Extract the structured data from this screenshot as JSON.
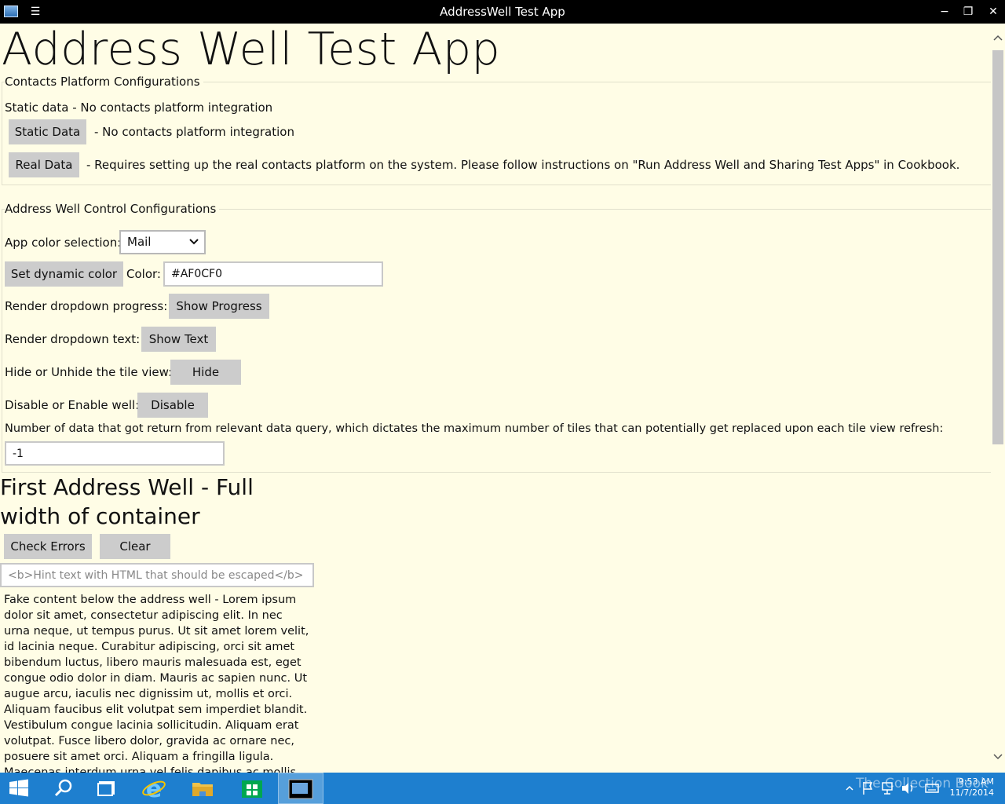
{
  "window": {
    "title": "AddressWell Test App",
    "controls": {
      "minimize": "−",
      "maximize": "❐",
      "close": "✕"
    }
  },
  "page": {
    "heading": "Address Well Test App"
  },
  "platform_section": {
    "legend": "Contacts Platform Configurations",
    "static_label": "Static data - No contacts platform integration",
    "static_button": "Static Data",
    "static_desc": "- No contacts platform integration",
    "real_button": "Real Data",
    "real_desc": "- Requires setting up the real contacts platform on the system. Please follow instructions on \"Run Address Well and Sharing Test Apps\" in Cookbook."
  },
  "control_section": {
    "legend": "Address Well Control Configurations",
    "color_selection_label": "App color selection:",
    "color_selection_value": "Mail",
    "set_dynamic_button": "Set dynamic color",
    "color_label": "Color:",
    "color_value": "#AF0CF0",
    "progress_label": "Render dropdown progress:",
    "progress_button": "Show Progress",
    "text_label": "Render dropdown text:",
    "text_button": "Show Text",
    "tile_label": "Hide or Unhide the tile view:",
    "tile_button": "Hide",
    "disable_label": "Disable or Enable well:",
    "disable_button": "Disable",
    "query_label": "Number of data that got return from relevant data query, which dictates the maximum number of tiles that can potentially get replaced upon each tile view refresh:",
    "query_value": "-1"
  },
  "first_well": {
    "heading": "First Address Well - Full width of container",
    "check_errors_button": "Check Errors",
    "clear_button": "Clear",
    "hint_placeholder": "<b>Hint text with HTML that should be escaped</b>",
    "content_text": "Fake content below the address well - Lorem ipsum dolor sit amet, consectetur adipiscing elit. In nec urna neque, ut tempus purus. Ut sit amet lorem velit, id lacinia neque. Curabitur adipiscing, orci sit amet bibendum luctus, libero mauris malesuada est, eget congue odio dolor in diam. Mauris ac sapien nunc. Ut augue arcu, iaculis nec dignissim ut, mollis et orci. Aliquam faucibus elit volutpat sem imperdiet blandit. Vestibulum congue lacinia sollicitudin. Aliquam erat volutpat. Fusce libero dolor, gravida ac ornare nec, posuere sit amet orci. Aliquam a fringilla ligula. Maecenas interdum urna vel felis dapibus ac mollis"
  },
  "taskbar": {
    "items": [
      "start-icon",
      "search-icon",
      "task-view-icon",
      "internet-explorer-icon",
      "file-explorer-icon",
      "store-icon",
      "addresswell-app-icon"
    ],
    "watermark": "The Collection Book",
    "time": "9:53 AM",
    "date": "11/7/2014",
    "accent": "#1e7fcf"
  },
  "colors": {
    "background": "#fffde6",
    "button": "#cccccc",
    "titlebar": "#000000"
  }
}
